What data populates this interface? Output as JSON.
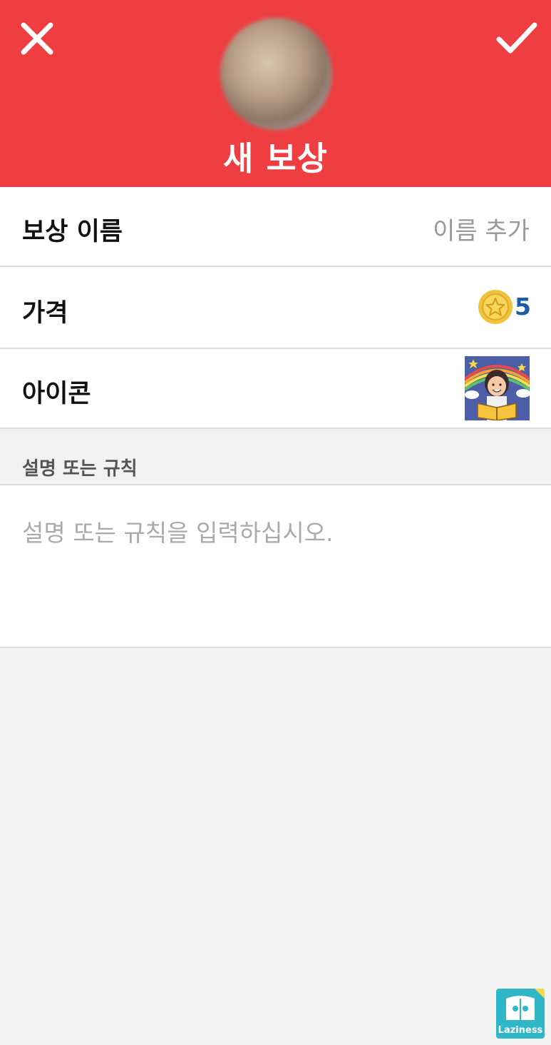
{
  "header": {
    "title": "새 보상",
    "close_icon": "close-icon",
    "confirm_icon": "check-icon",
    "color": "#ef3e42"
  },
  "form": {
    "name": {
      "label": "보상 이름",
      "placeholder": "이름 추가"
    },
    "price": {
      "label": "가격",
      "value": "5",
      "coin_icon": "star-coin-icon"
    },
    "icon": {
      "label": "아이콘",
      "icon": "child-reading-book-icon"
    }
  },
  "description": {
    "section_label": "설명 또는 규칙",
    "placeholder": "설명 또는 규칙을 입력하십시오."
  },
  "watermark": {
    "text": "Laziness"
  }
}
